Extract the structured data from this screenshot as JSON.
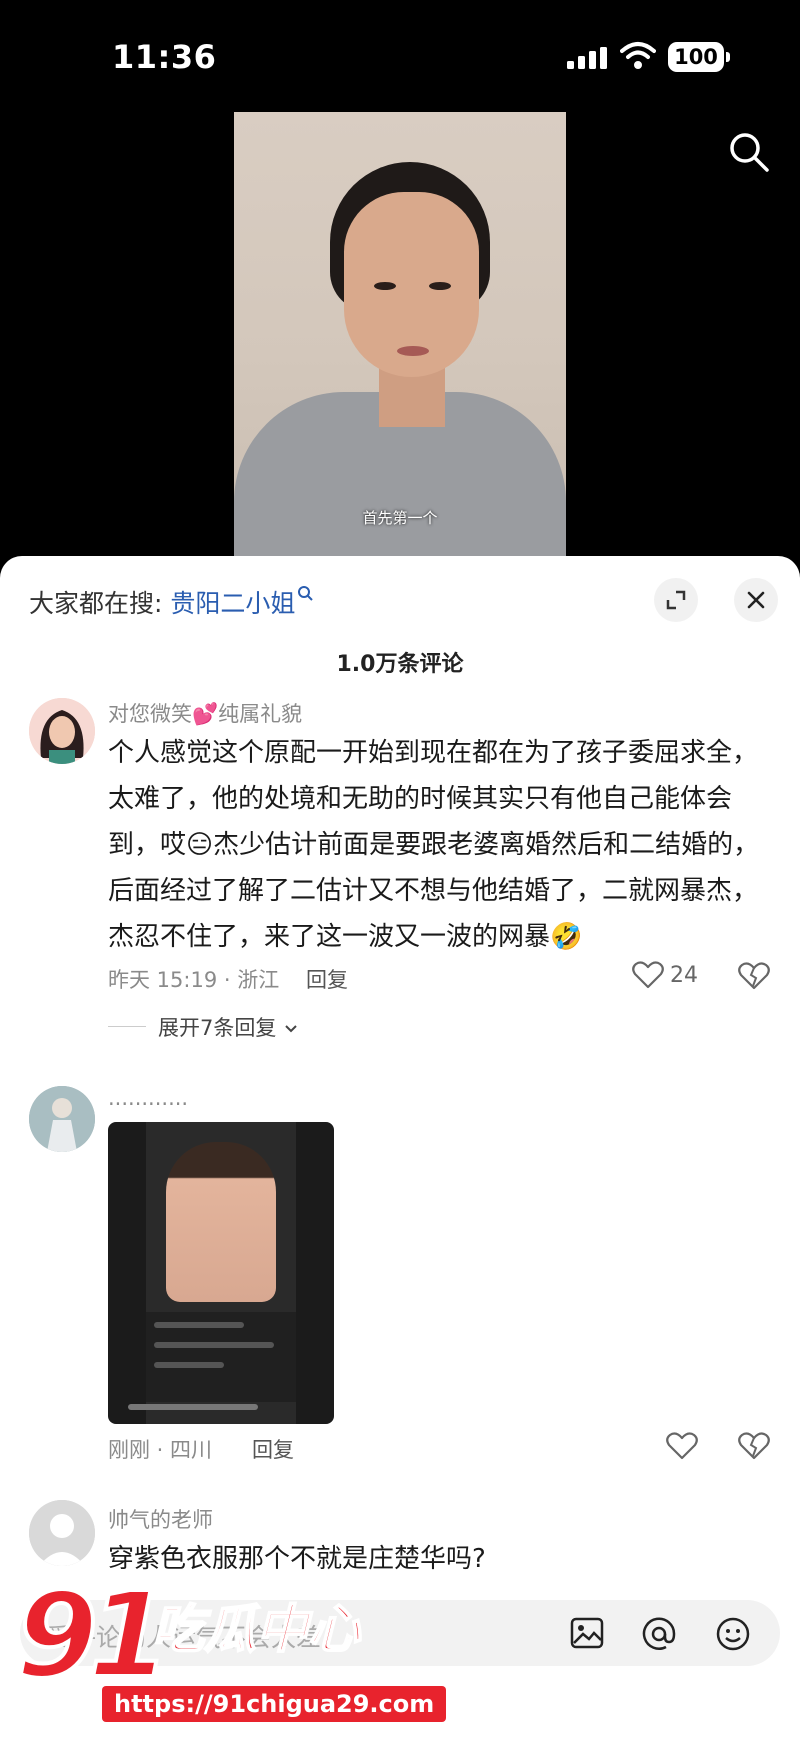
{
  "status": {
    "time": "11:36",
    "battery": "100"
  },
  "video": {
    "subtitle": "首先第一个"
  },
  "sheet": {
    "hot_prefix": "大家都在搜:",
    "hot_keyword": "贵阳二小姐",
    "comment_count": "1.0万条评论",
    "comments": [
      {
        "username": "对您微笑💕纯属礼貌",
        "text": "个人感觉这个原配一开始到现在都在为了孩子委屈求全，太难了，他的处境和无助的时候其实只有他自己能体会到，哎😑杰少估计前面是要跟老婆离婚然后和二结婚的，后面经过了解了二估计又不想与他结婚了，二就网暴杰，杰忍不住了，来了这一波又一波的网暴🤣",
        "meta": "昨天 15:19 · 浙江",
        "reply": "回复",
        "likes": "24",
        "expand": "展开7条回复"
      },
      {
        "username": "............",
        "meta": "刚刚 · 四川",
        "reply": "回复"
      },
      {
        "username": "帅气的老师",
        "text": "穿紫色衣服那个不就是庄楚华吗?"
      }
    ]
  },
  "input": {
    "placeholder": "爱评论的人运气不会太差"
  },
  "watermark": {
    "number": "91",
    "name": "吃瓜中心",
    "url": "https://91chigua29.com"
  },
  "colors": {
    "accent_link": "#2a5db0",
    "watermark": "#e8232d"
  }
}
